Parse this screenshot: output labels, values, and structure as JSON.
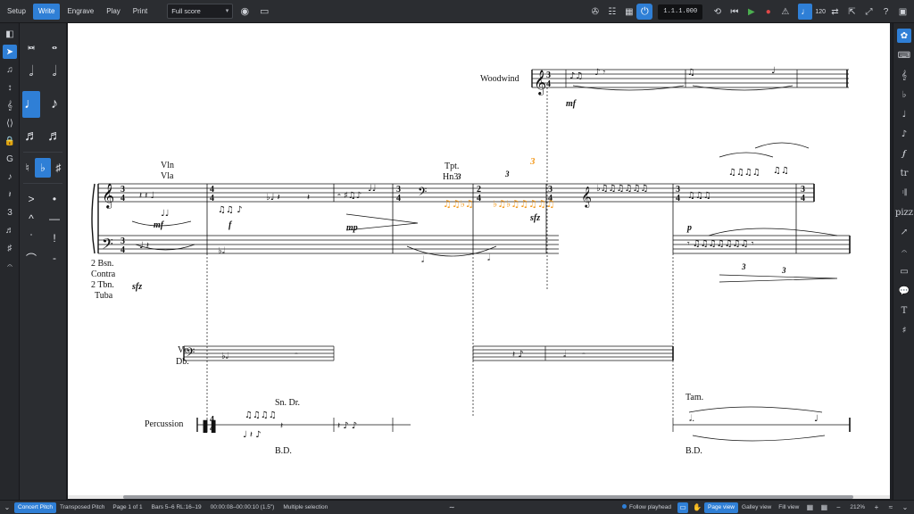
{
  "toolbar": {
    "modes": [
      "Setup",
      "Write",
      "Engrave",
      "Play",
      "Print"
    ],
    "active_mode": "Write",
    "layout": "Full score",
    "time_display": "1.1.1.000",
    "tempo": "120"
  },
  "left_toolbox": {
    "icons": [
      "panel-toggle-icon",
      "select-icon",
      "notes-input-icon",
      "slash-icon",
      "transpose-icon",
      "tuplet-icon",
      "lock-icon",
      "clef-icon",
      "key-icon",
      "rest-icon",
      "voice-icon",
      "split-stem-icon",
      "ornament-icon",
      "tie-icon"
    ]
  },
  "notes_panel": {
    "rows": [
      [
        "𝅜",
        "𝅝"
      ],
      [
        "𝅗𝅥",
        "𝅗𝅥"
      ],
      [
        "♪",
        "♪"
      ],
      [
        "♬",
        "♬"
      ],
      [
        "♮",
        "♭",
        "♯"
      ],
      [
        ">",
        "•"
      ],
      [
        "^",
        "—"
      ],
      [
        "ˈ",
        "!"
      ],
      [
        "⌒",
        "-"
      ]
    ]
  },
  "score": {
    "system1_label": "Woodwind",
    "labels": {
      "vln_vla": [
        "Vln",
        "Vla"
      ],
      "brass": [
        "2 Bsn.",
        "Contra",
        "2 Tbn.",
        "Tuba"
      ],
      "vc_db": [
        "Vc.",
        "Db."
      ],
      "percussion": "Percussion",
      "tpt_hn": [
        "Tpt.",
        "Hn3"
      ],
      "sn_dr": "Sn. Dr.",
      "bd1": "B.D.",
      "tam": "Tam.",
      "bd2": "B.D."
    },
    "dynamics": {
      "mf_top": "mf",
      "mf_mid": "mf",
      "sfz_low": "sfz",
      "f_mid": "f",
      "mp_mid": "mp",
      "sfz_mid": "sfz",
      "p_right": "p"
    },
    "tuplets": [
      "3",
      "3",
      "3",
      "3"
    ]
  },
  "statusbar": {
    "concert_pitch": "Concert Pitch",
    "transposed_pitch": "Transposed Pitch",
    "page": "Page 1 of 1",
    "bars": "Bars 5–6 RL:16–19",
    "time": "00:00:08–00:00:10 (1.5\")",
    "selection": "Multiple selection",
    "follow_playhead": "Follow playhead",
    "page_view": "Page view",
    "galley_view": "Galley view",
    "fill_view": "Fill view",
    "zoom": "212%"
  },
  "colors": {
    "accent": "#2f7fd6",
    "selection": "#f39a1e"
  }
}
